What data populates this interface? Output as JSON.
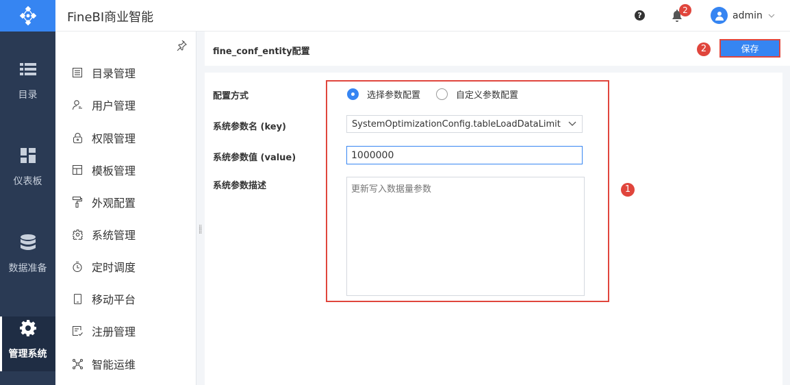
{
  "rail": {
    "items": [
      {
        "label": "目录",
        "icon": "list-icon"
      },
      {
        "label": "仪表板",
        "icon": "dashboard-icon"
      },
      {
        "label": "数据准备",
        "icon": "database-icon"
      },
      {
        "label": "管理系统",
        "icon": "gear-icon",
        "active": true
      }
    ]
  },
  "header": {
    "app_title": "FineBI商业智能",
    "help_glyph": "?",
    "notification_count": "2",
    "username": "admin"
  },
  "subnav": {
    "items": [
      {
        "label": "目录管理",
        "icon": "catalog-icon"
      },
      {
        "label": "用户管理",
        "icon": "user-icon"
      },
      {
        "label": "权限管理",
        "icon": "lock-icon"
      },
      {
        "label": "模板管理",
        "icon": "template-icon"
      },
      {
        "label": "外观配置",
        "icon": "paint-roller-icon"
      },
      {
        "label": "系统管理",
        "icon": "settings-icon"
      },
      {
        "label": "定时调度",
        "icon": "timer-icon"
      },
      {
        "label": "移动平台",
        "icon": "mobile-icon"
      },
      {
        "label": "注册管理",
        "icon": "register-icon"
      },
      {
        "label": "智能运维",
        "icon": "network-icon"
      }
    ]
  },
  "page": {
    "title": "fine_conf_entity配置",
    "save_label": "保存",
    "marker_save": "2",
    "marker_form": "1"
  },
  "form": {
    "config_mode_label": "配置方式",
    "radio_select_label": "选择参数配置",
    "radio_custom_label": "自定义参数配置",
    "key_label": "系统参数名 (key)",
    "key_value": "SystemOptimizationConfig.tableLoadDataLimit",
    "value_label": "系统参数值 (value)",
    "value_value": "1000000",
    "desc_label": "系统参数描述",
    "desc_placeholder": "更新写入数据量参数"
  },
  "colors": {
    "accent": "#3685f2",
    "rail_bg": "#2a3a54",
    "highlight": "#e0453c"
  }
}
